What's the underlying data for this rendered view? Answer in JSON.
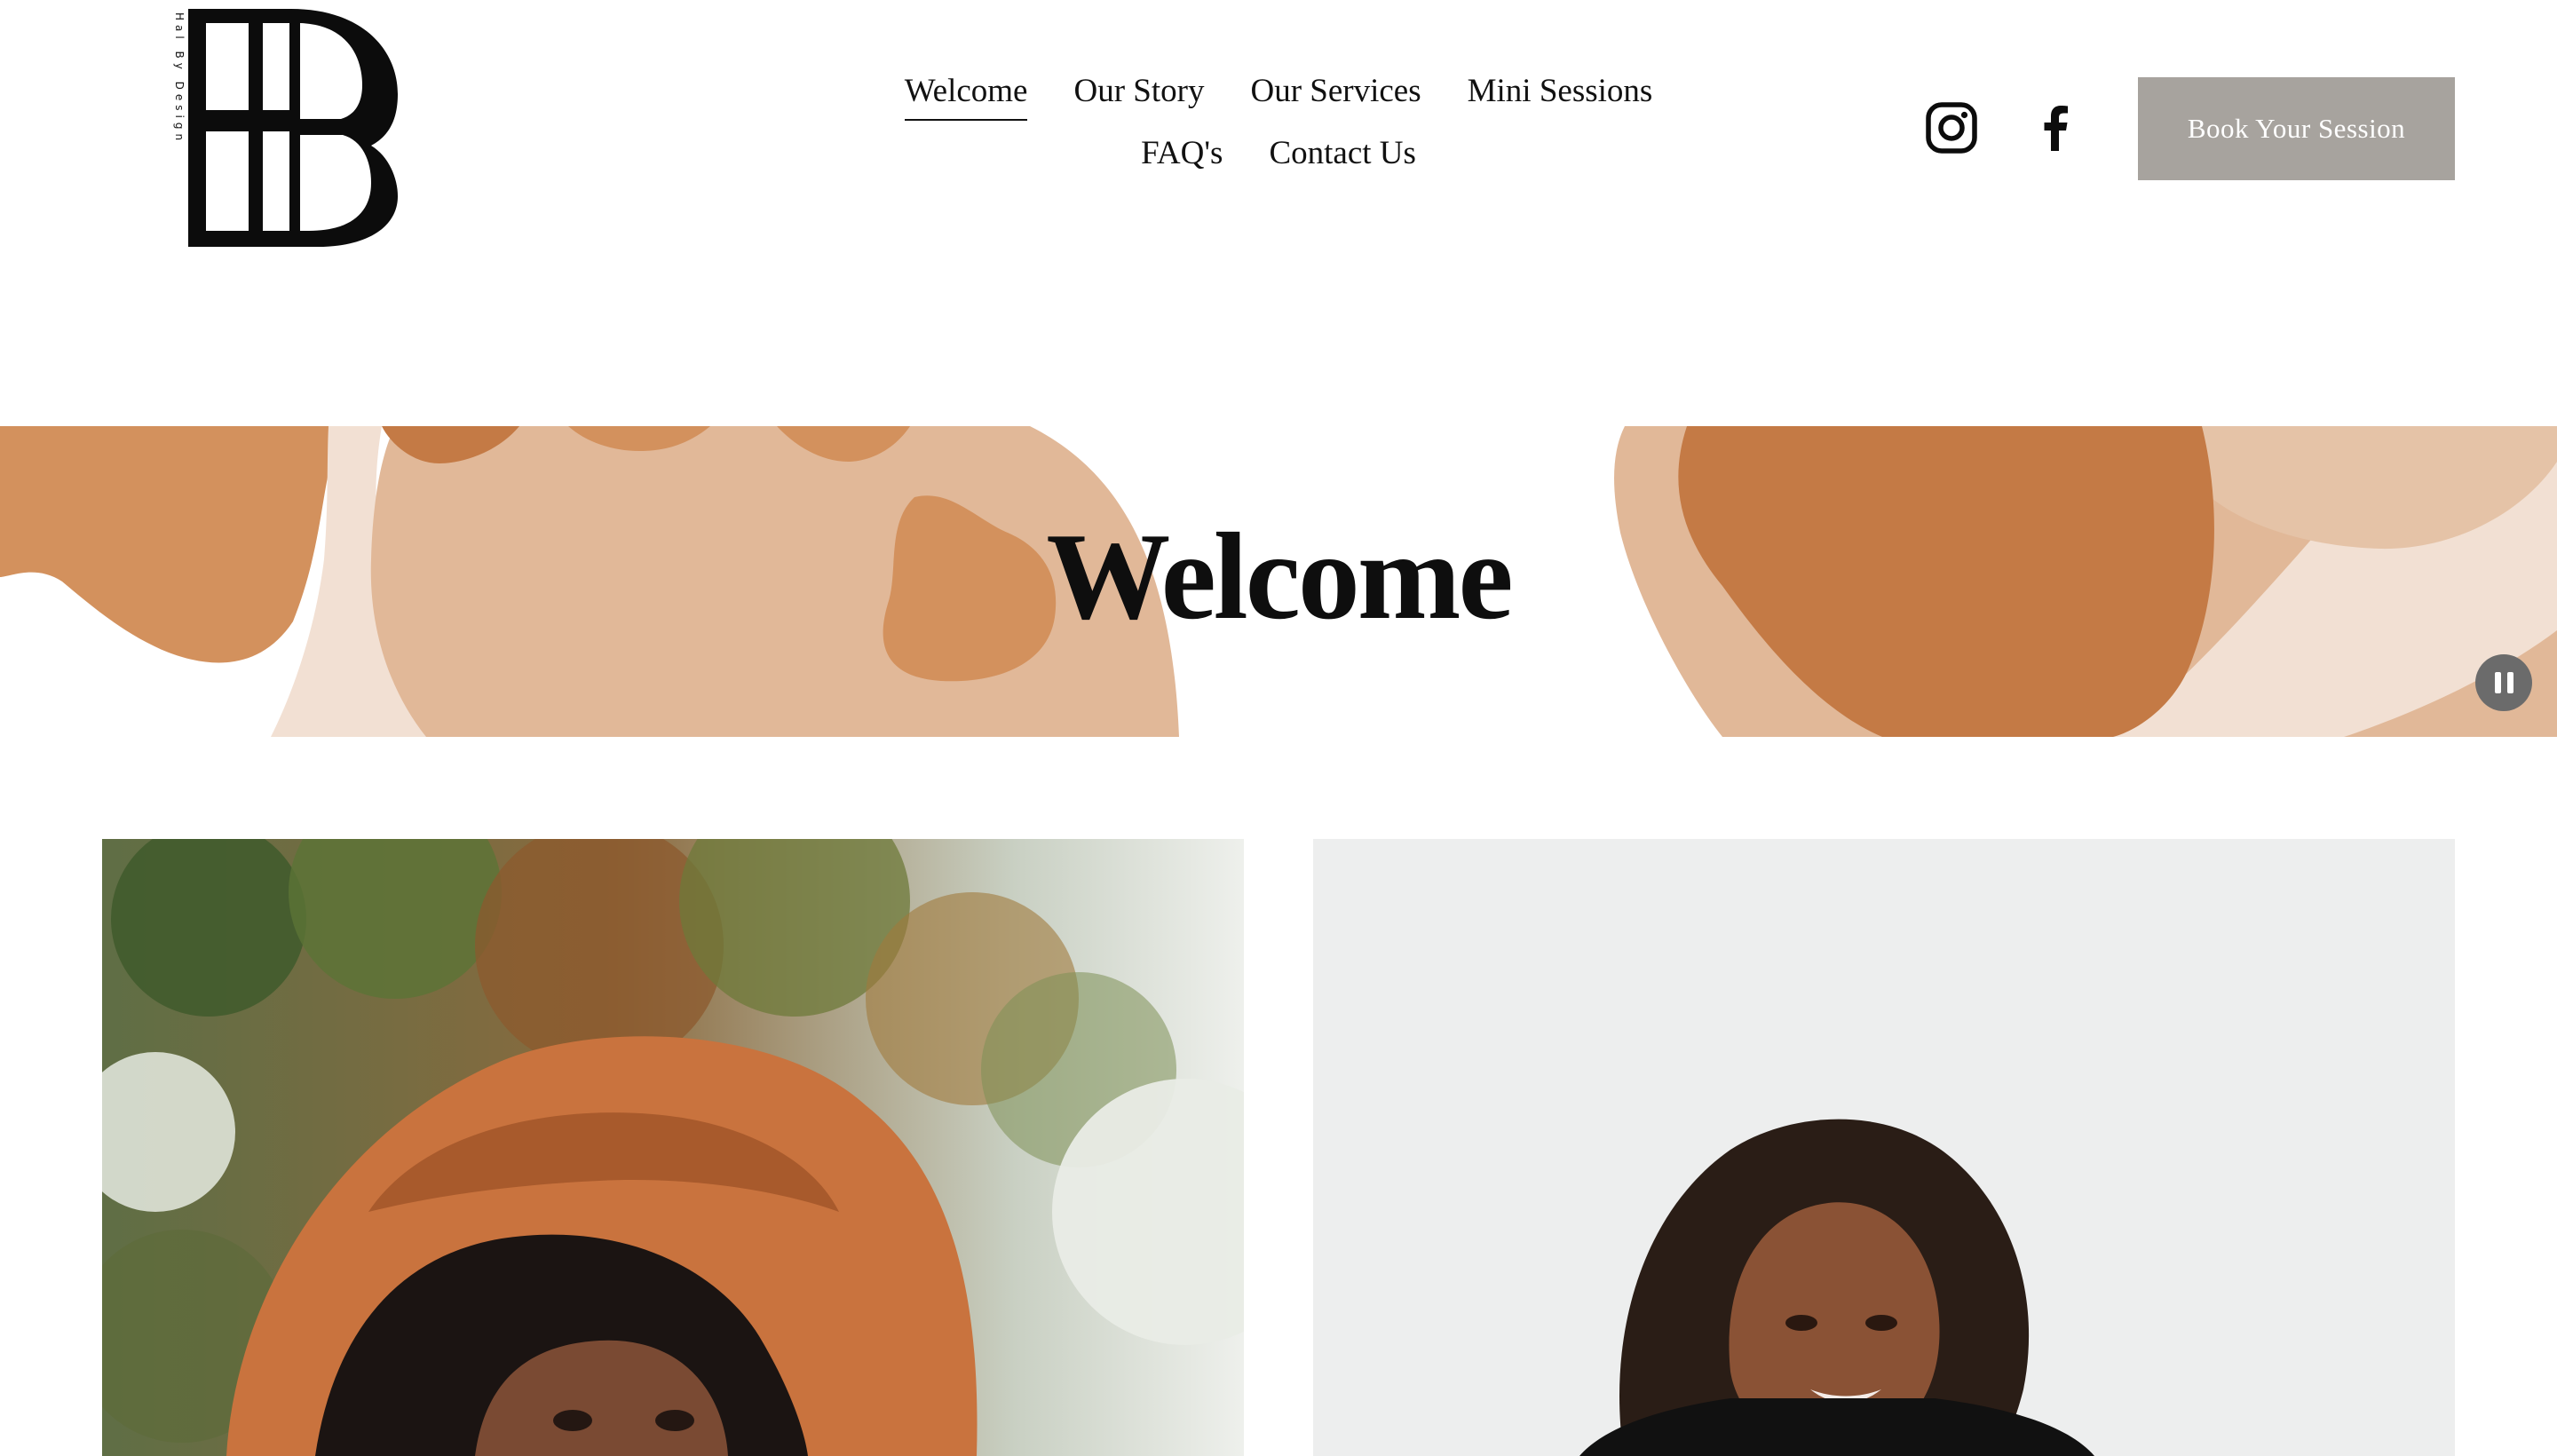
{
  "brand": {
    "logo_vertical_text": "Hal By Design",
    "logo_icon": "hbd-monogram"
  },
  "nav": {
    "row1": [
      "Welcome",
      "Our Story",
      "Our Services",
      "Mini Sessions"
    ],
    "row2": [
      "FAQ's",
      "Contact Us"
    ],
    "active": "Welcome"
  },
  "social": {
    "icons": [
      "instagram-icon",
      "facebook-icon"
    ]
  },
  "cta": {
    "book_label": "Book Your Session"
  },
  "hero": {
    "title": "Welcome",
    "pause_icon": "pause-icon"
  },
  "colors": {
    "accent_rust": "#c47a45",
    "accent_clay": "#d3915d",
    "accent_tan": "#e1b898",
    "accent_blush": "#f2e0d3",
    "button_gray": "#a7a39e"
  },
  "photos": {
    "left": "portrait-woman-orange-hat",
    "right": "portrait-woman-dark-jacket"
  }
}
